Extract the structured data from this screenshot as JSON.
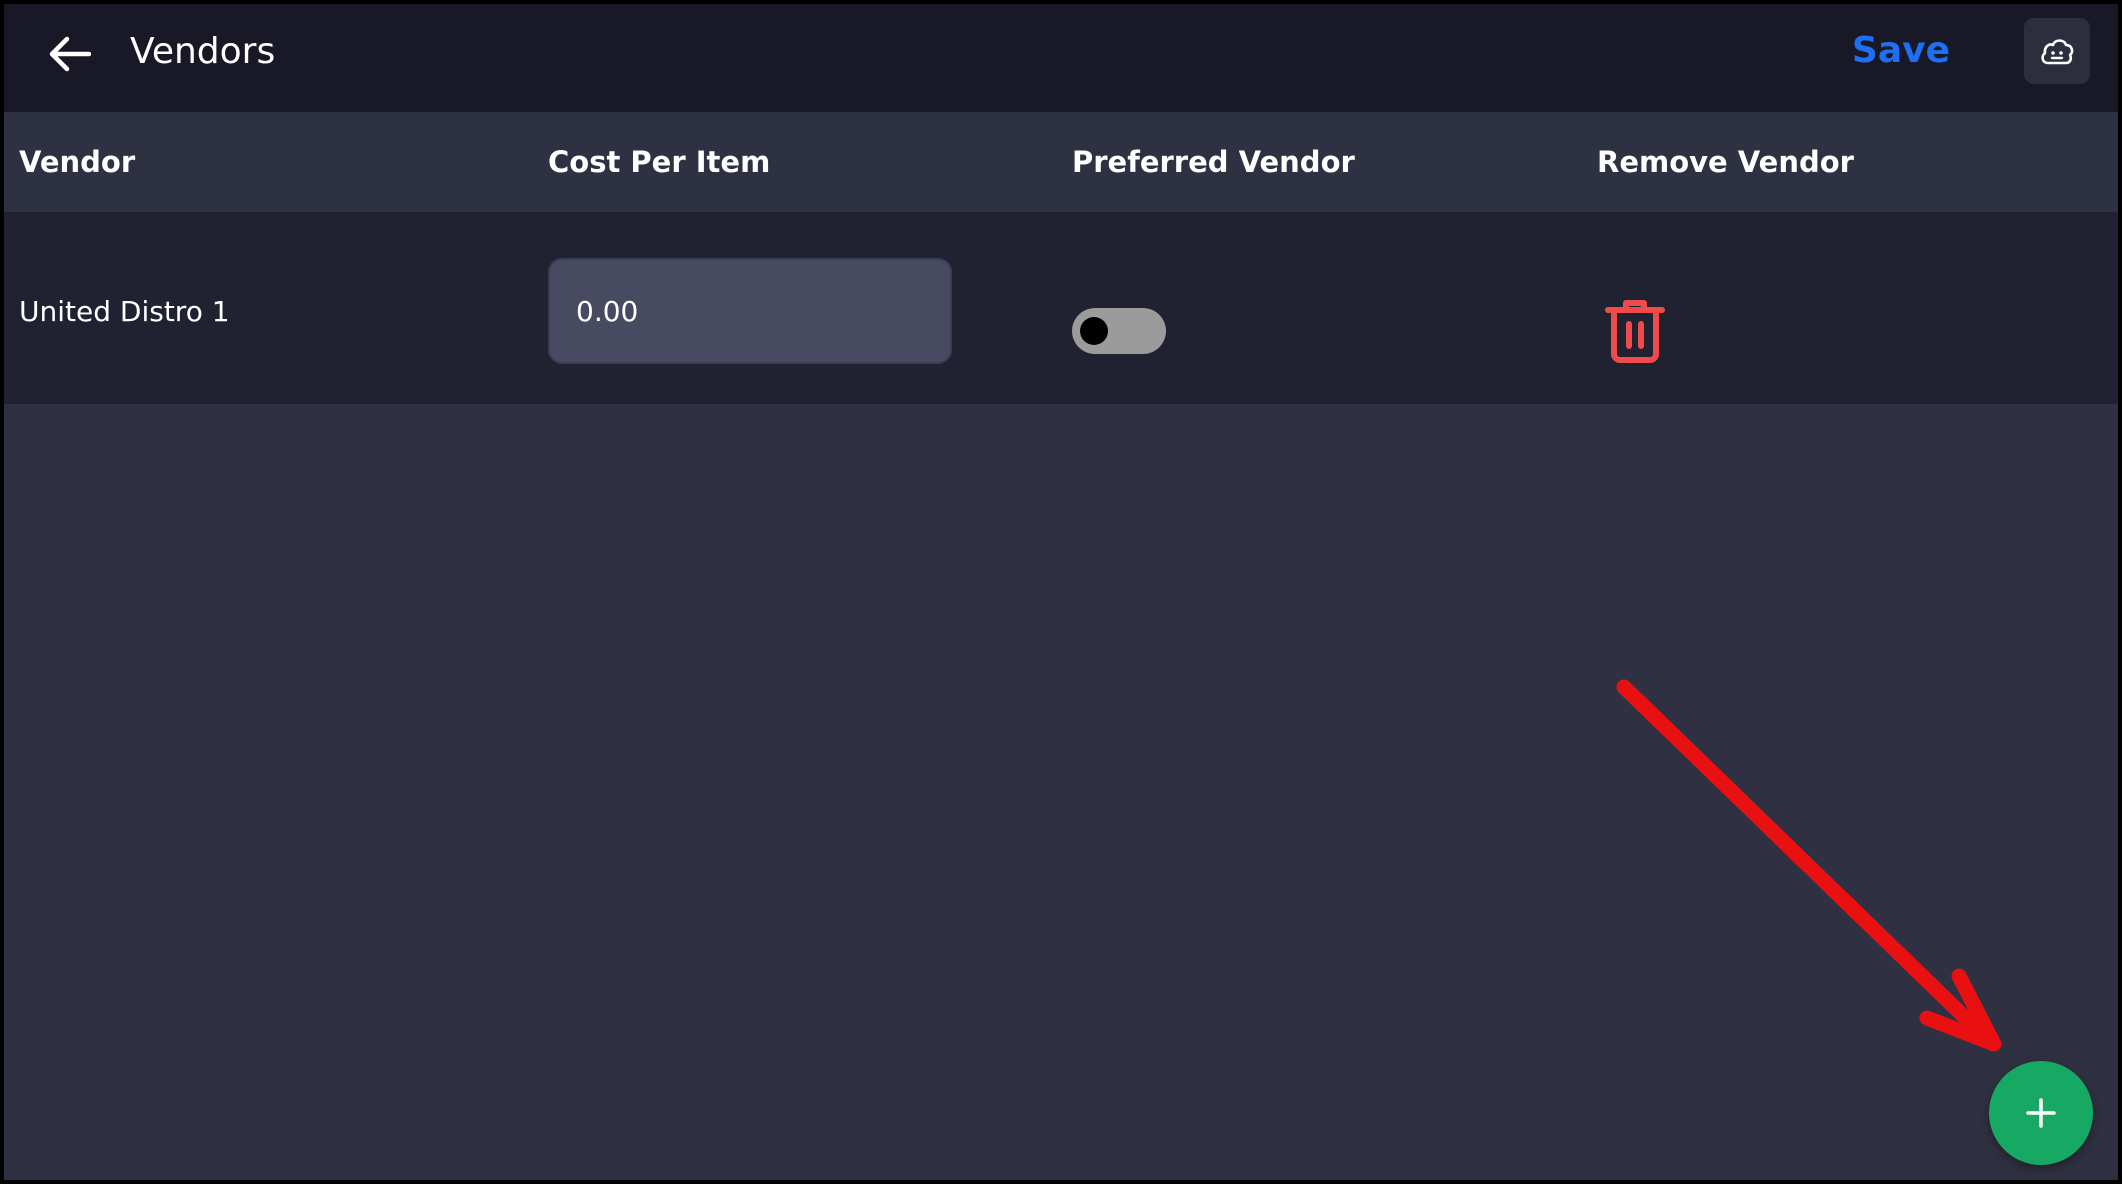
{
  "header": {
    "title": "Vendors",
    "save_label": "Save",
    "back_icon": "arrow-left-icon",
    "cloud_icon": "cloud-icon"
  },
  "table": {
    "columns": [
      "Vendor",
      "Cost Per Item",
      "Preferred Vendor",
      "Remove Vendor"
    ],
    "rows": [
      {
        "vendor": "United Distro 1",
        "cost_per_item": "0.00",
        "preferred": false,
        "remove_icon": "trash-icon"
      }
    ]
  },
  "fab": {
    "icon": "plus-icon"
  },
  "colors": {
    "topbar_bg": "#181827",
    "page_bg": "#2f3142",
    "row_bg": "#212231",
    "save_accent": "#1f6ff2",
    "delete_red": "#f04b4b",
    "fab_green": "#17a864",
    "annotation_red": "#e81010"
  }
}
